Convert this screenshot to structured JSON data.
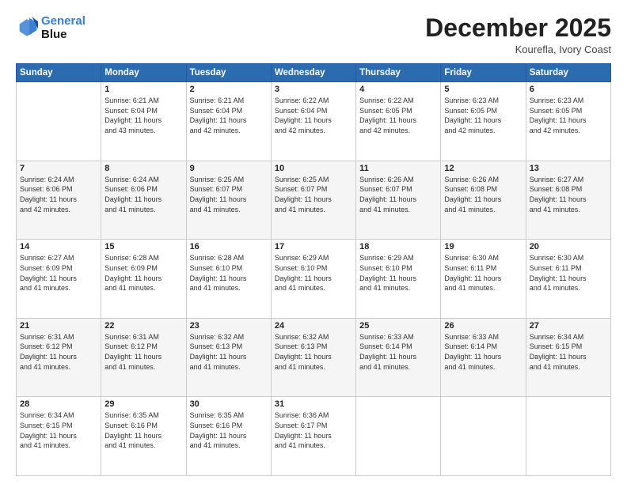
{
  "logo": {
    "line1": "General",
    "line2": "Blue"
  },
  "title": "December 2025",
  "location": "Kourefla, Ivory Coast",
  "weekdays": [
    "Sunday",
    "Monday",
    "Tuesday",
    "Wednesday",
    "Thursday",
    "Friday",
    "Saturday"
  ],
  "weeks": [
    [
      {
        "day": "",
        "info": ""
      },
      {
        "day": "1",
        "info": "Sunrise: 6:21 AM\nSunset: 6:04 PM\nDaylight: 11 hours\nand 43 minutes."
      },
      {
        "day": "2",
        "info": "Sunrise: 6:21 AM\nSunset: 6:04 PM\nDaylight: 11 hours\nand 42 minutes."
      },
      {
        "day": "3",
        "info": "Sunrise: 6:22 AM\nSunset: 6:04 PM\nDaylight: 11 hours\nand 42 minutes."
      },
      {
        "day": "4",
        "info": "Sunrise: 6:22 AM\nSunset: 6:05 PM\nDaylight: 11 hours\nand 42 minutes."
      },
      {
        "day": "5",
        "info": "Sunrise: 6:23 AM\nSunset: 6:05 PM\nDaylight: 11 hours\nand 42 minutes."
      },
      {
        "day": "6",
        "info": "Sunrise: 6:23 AM\nSunset: 6:05 PM\nDaylight: 11 hours\nand 42 minutes."
      }
    ],
    [
      {
        "day": "7",
        "info": "Sunrise: 6:24 AM\nSunset: 6:06 PM\nDaylight: 11 hours\nand 42 minutes."
      },
      {
        "day": "8",
        "info": "Sunrise: 6:24 AM\nSunset: 6:06 PM\nDaylight: 11 hours\nand 41 minutes."
      },
      {
        "day": "9",
        "info": "Sunrise: 6:25 AM\nSunset: 6:07 PM\nDaylight: 11 hours\nand 41 minutes."
      },
      {
        "day": "10",
        "info": "Sunrise: 6:25 AM\nSunset: 6:07 PM\nDaylight: 11 hours\nand 41 minutes."
      },
      {
        "day": "11",
        "info": "Sunrise: 6:26 AM\nSunset: 6:07 PM\nDaylight: 11 hours\nand 41 minutes."
      },
      {
        "day": "12",
        "info": "Sunrise: 6:26 AM\nSunset: 6:08 PM\nDaylight: 11 hours\nand 41 minutes."
      },
      {
        "day": "13",
        "info": "Sunrise: 6:27 AM\nSunset: 6:08 PM\nDaylight: 11 hours\nand 41 minutes."
      }
    ],
    [
      {
        "day": "14",
        "info": "Sunrise: 6:27 AM\nSunset: 6:09 PM\nDaylight: 11 hours\nand 41 minutes."
      },
      {
        "day": "15",
        "info": "Sunrise: 6:28 AM\nSunset: 6:09 PM\nDaylight: 11 hours\nand 41 minutes."
      },
      {
        "day": "16",
        "info": "Sunrise: 6:28 AM\nSunset: 6:10 PM\nDaylight: 11 hours\nand 41 minutes."
      },
      {
        "day": "17",
        "info": "Sunrise: 6:29 AM\nSunset: 6:10 PM\nDaylight: 11 hours\nand 41 minutes."
      },
      {
        "day": "18",
        "info": "Sunrise: 6:29 AM\nSunset: 6:10 PM\nDaylight: 11 hours\nand 41 minutes."
      },
      {
        "day": "19",
        "info": "Sunrise: 6:30 AM\nSunset: 6:11 PM\nDaylight: 11 hours\nand 41 minutes."
      },
      {
        "day": "20",
        "info": "Sunrise: 6:30 AM\nSunset: 6:11 PM\nDaylight: 11 hours\nand 41 minutes."
      }
    ],
    [
      {
        "day": "21",
        "info": "Sunrise: 6:31 AM\nSunset: 6:12 PM\nDaylight: 11 hours\nand 41 minutes."
      },
      {
        "day": "22",
        "info": "Sunrise: 6:31 AM\nSunset: 6:12 PM\nDaylight: 11 hours\nand 41 minutes."
      },
      {
        "day": "23",
        "info": "Sunrise: 6:32 AM\nSunset: 6:13 PM\nDaylight: 11 hours\nand 41 minutes."
      },
      {
        "day": "24",
        "info": "Sunrise: 6:32 AM\nSunset: 6:13 PM\nDaylight: 11 hours\nand 41 minutes."
      },
      {
        "day": "25",
        "info": "Sunrise: 6:33 AM\nSunset: 6:14 PM\nDaylight: 11 hours\nand 41 minutes."
      },
      {
        "day": "26",
        "info": "Sunrise: 6:33 AM\nSunset: 6:14 PM\nDaylight: 11 hours\nand 41 minutes."
      },
      {
        "day": "27",
        "info": "Sunrise: 6:34 AM\nSunset: 6:15 PM\nDaylight: 11 hours\nand 41 minutes."
      }
    ],
    [
      {
        "day": "28",
        "info": "Sunrise: 6:34 AM\nSunset: 6:15 PM\nDaylight: 11 hours\nand 41 minutes."
      },
      {
        "day": "29",
        "info": "Sunrise: 6:35 AM\nSunset: 6:16 PM\nDaylight: 11 hours\nand 41 minutes."
      },
      {
        "day": "30",
        "info": "Sunrise: 6:35 AM\nSunset: 6:16 PM\nDaylight: 11 hours\nand 41 minutes."
      },
      {
        "day": "31",
        "info": "Sunrise: 6:36 AM\nSunset: 6:17 PM\nDaylight: 11 hours\nand 41 minutes."
      },
      {
        "day": "",
        "info": ""
      },
      {
        "day": "",
        "info": ""
      },
      {
        "day": "",
        "info": ""
      }
    ]
  ]
}
